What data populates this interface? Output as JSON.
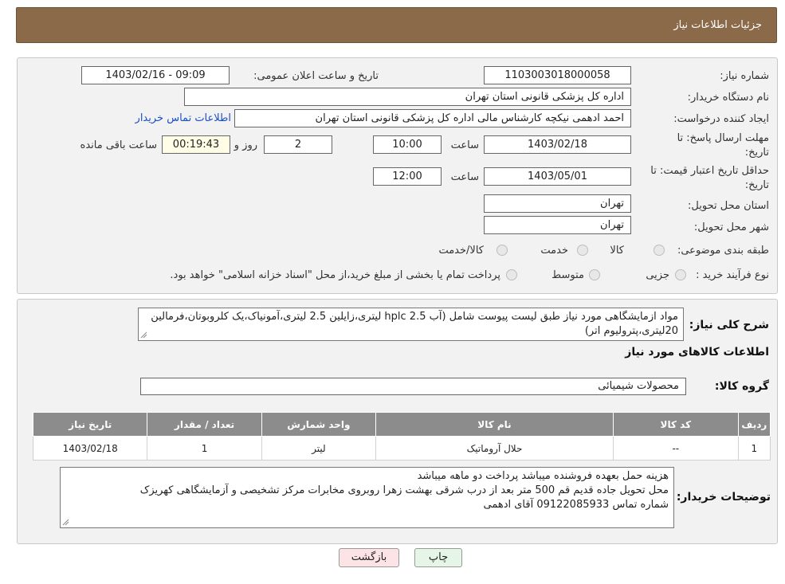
{
  "header": {
    "title": "جزئیات اطلاعات نیاز"
  },
  "form": {
    "need_number_label": "شماره نیاز:",
    "need_number": "1103003018000058",
    "announce_label": "تاریخ و ساعت اعلان عمومی:",
    "announce_value": "1403/02/16 - 09:09",
    "buyer_org_label": "نام دستگاه خریدار:",
    "buyer_org": "اداره کل پزشکی قانونی استان تهران",
    "creator_label": "ایجاد کننده درخواست:",
    "creator": "احمد ادهمی نیکچه کارشناس مالی اداره کل پزشکی قانونی استان تهران",
    "contact_link": "اطلاعات تماس خریدار",
    "deadline_label_1": "مهلت ارسال پاسخ: تا",
    "deadline_label_2": "تاریخ:",
    "deadline_date": "1403/02/18",
    "time_label": "ساعت",
    "deadline_time": "10:00",
    "days_value": "2",
    "days_label": "روز و",
    "remaining_time": "00:19:43",
    "remaining_label": "ساعت باقی مانده",
    "validity_label_1": "حداقل تاریخ اعتبار قیمت: تا",
    "validity_label_2": "تاریخ:",
    "validity_date": "1403/05/01",
    "validity_time": "12:00",
    "province_label": "استان محل تحویل:",
    "province": "تهران",
    "city_label": "شهر محل تحویل:",
    "city": "تهران",
    "category_label": "طبقه بندی موضوعی:",
    "category_options": [
      "کالا",
      "خدمت",
      "کالا/خدمت"
    ],
    "process_label": "نوع فرآیند خرید :",
    "process_options": [
      "جزیی",
      "متوسط"
    ],
    "process_note": "پرداخت تمام یا بخشی از مبلغ خرید،از محل \"اسناد خزانه اسلامی\" خواهد بود."
  },
  "details": {
    "summary_label": "شرح کلی نیاز:",
    "summary_text": "مواد ازمایشگاهی مورد نیاز طبق لیست پیوست شامل (آب hplc 2.5 لیتری،زایلین 2.5 لیتری،آمونیاک،یک کلروبوتان،فرمالین 20لیتری،پترولیوم اتر)",
    "goods_info_title": "اطلاعات کالاهای مورد نیاز",
    "goods_group_label": "گروه کالا:",
    "goods_group": "محصولات شیمیائی",
    "table_headers": [
      "ردیف",
      "کد کالا",
      "نام کالا",
      "واحد شمارش",
      "تعداد / مقدار",
      "تاریخ نیاز"
    ],
    "table_rows": [
      [
        "1",
        "--",
        "حلال آروماتیک",
        "لیتر",
        "1",
        "1403/02/18"
      ]
    ],
    "buyer_notes_label": "توضیحات خریدار:",
    "buyer_notes_lines": [
      "هزینه حمل بعهده فروشنده میباشد پرداخت دو ماهه میباشد",
      "محل تحویل جاده قدیم قم 500 متر بعد از درب شرقی بهشت زهرا روبروی مخابرات مرکز تشخیصی و آزمایشگاهی کهریزک",
      "شماره تماس 09122085933 آقای ادهمی"
    ]
  },
  "buttons": {
    "print": "چاپ",
    "back": "بازگشت"
  },
  "colors": {
    "header_bg": "#8b6a4a",
    "panel_bg": "#f2f2f2",
    "table_header_bg": "#8c8c8c",
    "back_btn_bg": "#fbe3e6",
    "print_btn_bg": "#e6f6e6",
    "link": "#1a4fc8"
  }
}
